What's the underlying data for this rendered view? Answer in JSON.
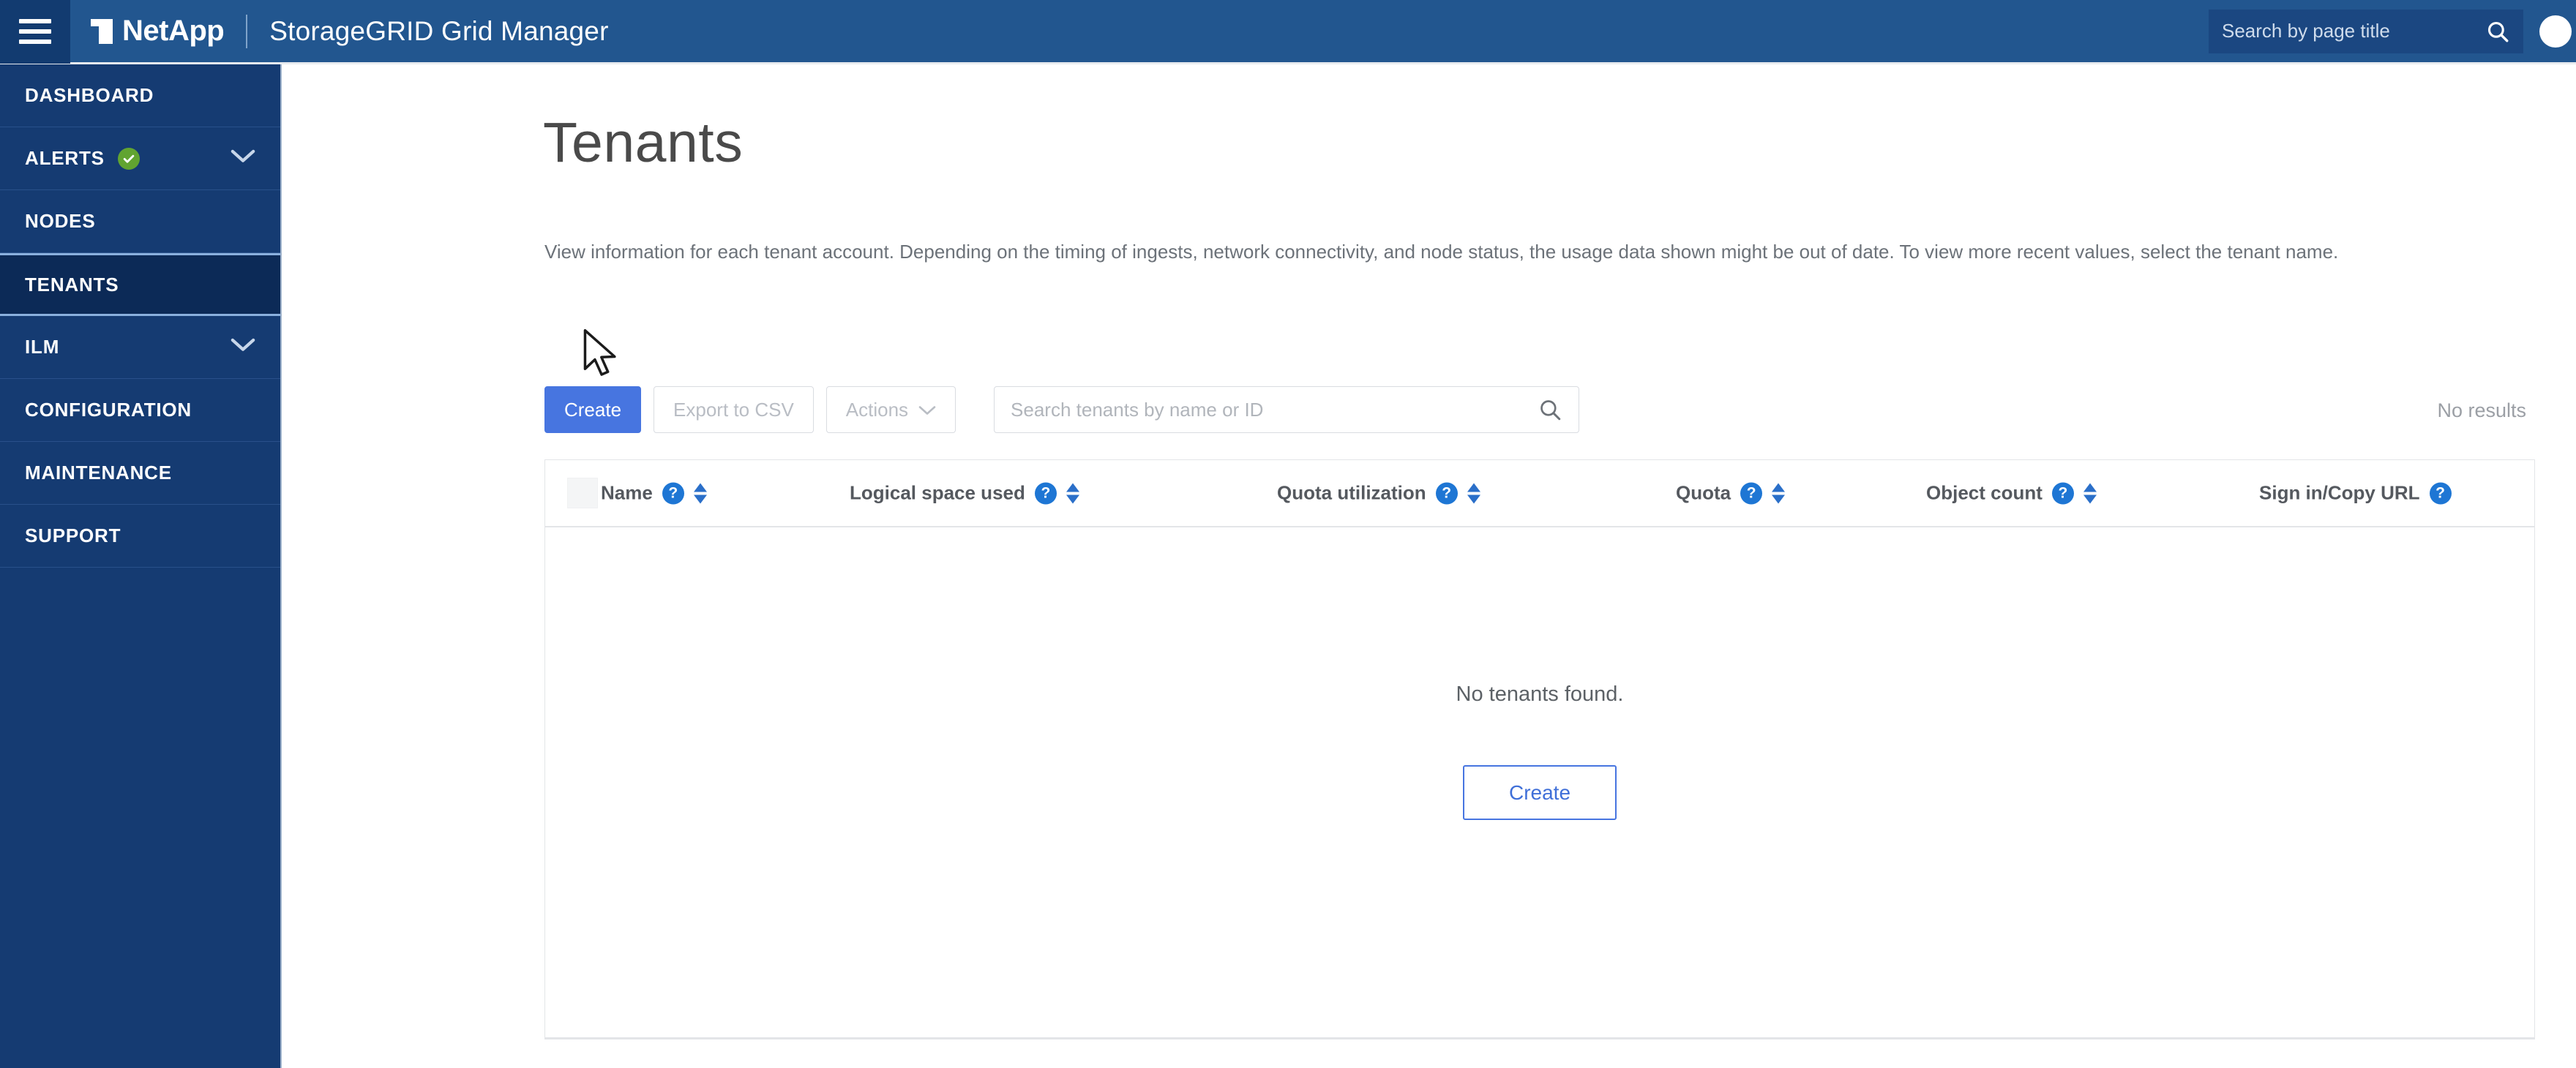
{
  "header": {
    "menu_icon": "hamburger-menu-icon",
    "brand": "NetApp",
    "app_title": "StorageGRID Grid Manager",
    "search": {
      "placeholder": "Search by page title",
      "value": "",
      "icon": "search-icon"
    },
    "help_icon": "help-circle-icon"
  },
  "sidebar": {
    "items": [
      {
        "label": "DASHBOARD",
        "active": false,
        "expandable": false,
        "status_icon": null
      },
      {
        "label": "ALERTS",
        "active": false,
        "expandable": true,
        "status_icon": "green-check-circle-icon"
      },
      {
        "label": "NODES",
        "active": false,
        "expandable": false,
        "status_icon": null
      },
      {
        "label": "TENANTS",
        "active": true,
        "expandable": false,
        "status_icon": null
      },
      {
        "label": "ILM",
        "active": false,
        "expandable": true,
        "status_icon": null
      },
      {
        "label": "CONFIGURATION",
        "active": false,
        "expandable": false,
        "status_icon": null
      },
      {
        "label": "MAINTENANCE",
        "active": false,
        "expandable": false,
        "status_icon": null
      },
      {
        "label": "SUPPORT",
        "active": false,
        "expandable": false,
        "status_icon": null
      }
    ]
  },
  "main": {
    "title": "Tenants",
    "description": "View information for each tenant account. Depending on the timing of ingests, network connectivity, and node status, the usage data shown might be out of date. To view more recent values, select the tenant name.",
    "toolbar": {
      "create_label": "Create",
      "export_label": "Export to CSV",
      "actions_label": "Actions",
      "actions_chevron": "chevron-down-icon",
      "search_placeholder": "Search tenants by name or ID",
      "search_value": "",
      "search_icon": "search-icon"
    },
    "results_status": "No results",
    "table": {
      "columns": [
        {
          "label": "Name",
          "help": true,
          "sortable": true
        },
        {
          "label": "Logical space used",
          "help": true,
          "sortable": true
        },
        {
          "label": "Quota utilization",
          "help": true,
          "sortable": true
        },
        {
          "label": "Quota",
          "help": true,
          "sortable": true
        },
        {
          "label": "Object count",
          "help": true,
          "sortable": true
        },
        {
          "label": "Sign in/Copy URL",
          "help": true,
          "sortable": false
        }
      ],
      "rows": [],
      "empty_message": "No tenants found.",
      "empty_action_label": "Create"
    }
  },
  "colors": {
    "header_blue": "#22568F",
    "sidebar_navy": "#153B72",
    "sidebar_active": "#0C2A57",
    "primary_button": "#4775e0",
    "accent_link": "#3f6fd8",
    "help_icon_blue": "#1e76d4",
    "status_green": "#61a431"
  }
}
